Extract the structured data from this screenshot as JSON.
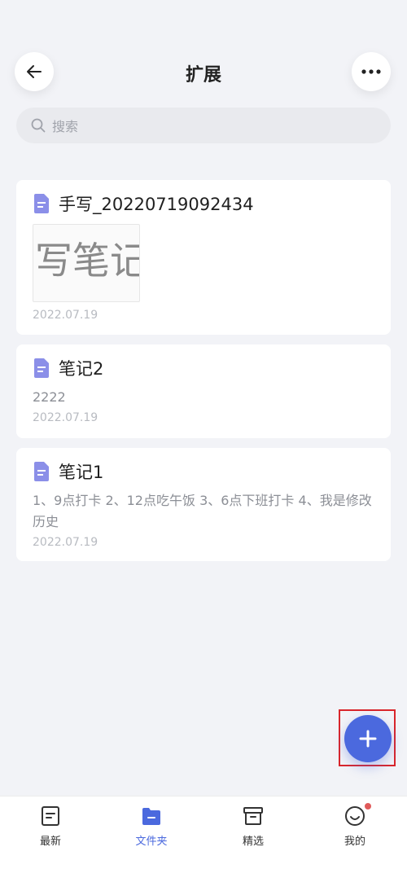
{
  "header": {
    "title": "扩展"
  },
  "search": {
    "placeholder": "搜索"
  },
  "notes": [
    {
      "title": "手写_20220719092434",
      "thumbnail_text": "写笔记",
      "date": "2022.07.19"
    },
    {
      "title": "笔记2",
      "body": "2222",
      "date": "2022.07.19"
    },
    {
      "title": "笔记1",
      "body": "1、9点打卡 2、12点吃午饭 3、6点下班打卡 4、我是修改历史",
      "date": "2022.07.19"
    }
  ],
  "tabs": [
    {
      "label": "最新",
      "icon": "note-icon",
      "active": false
    },
    {
      "label": "文件夹",
      "icon": "folder-icon",
      "active": true
    },
    {
      "label": "精选",
      "icon": "archive-icon",
      "active": false
    },
    {
      "label": "我的",
      "icon": "smile-icon",
      "active": false
    }
  ],
  "colors": {
    "accent": "#4b69de",
    "background": "#f2f3f7",
    "doc_icon": "#8b8fe8",
    "badge": "#e05a5a"
  }
}
